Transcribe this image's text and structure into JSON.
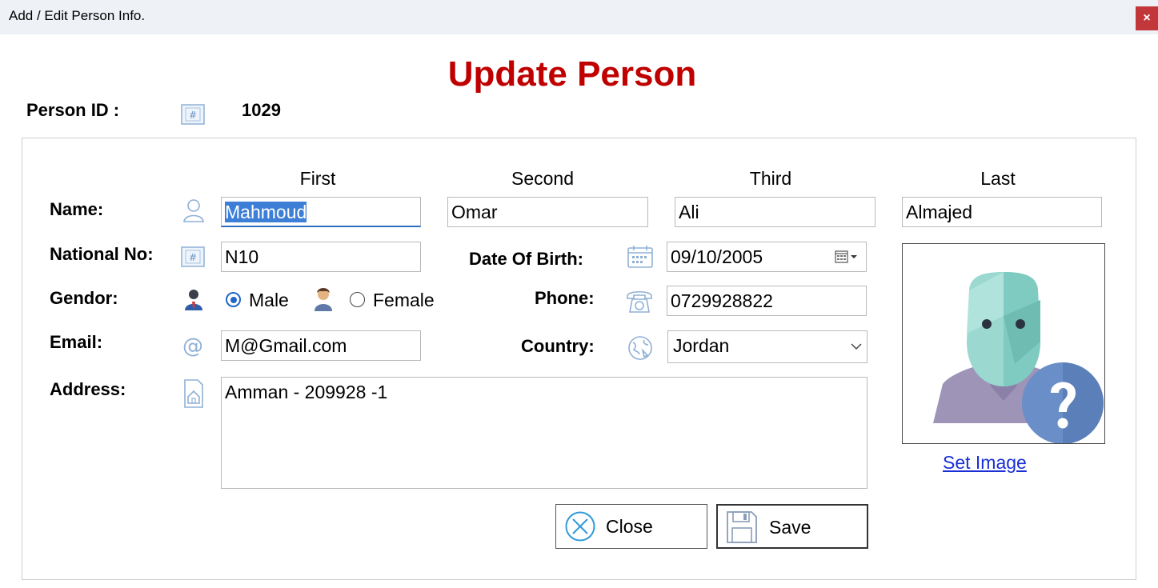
{
  "window": {
    "title": "Add / Edit Person Info.",
    "close_label": "×"
  },
  "heading": "Update Person",
  "person_id": {
    "label": "Person ID :",
    "value": "1029"
  },
  "name": {
    "label": "Name:",
    "columns": {
      "first": "First",
      "second": "Second",
      "third": "Third",
      "last": "Last"
    },
    "first": "Mahmoud",
    "second": "Omar",
    "third": "Ali",
    "last": "Almajed"
  },
  "national_no": {
    "label": "National No:",
    "value": "N10"
  },
  "gender": {
    "label": "Gendor:",
    "male": "Male",
    "female": "Female",
    "selected": "Male"
  },
  "email": {
    "label": "Email:",
    "value": "M@Gmail.com"
  },
  "address": {
    "label": "Address:",
    "value": "Amman - 209928 -1"
  },
  "dob": {
    "label": "Date Of Birth:",
    "value": "09/10/2005"
  },
  "phone": {
    "label": "Phone:",
    "value": "0729928822"
  },
  "country": {
    "label": "Country:",
    "value": "Jordan"
  },
  "image": {
    "link": "Set Image"
  },
  "buttons": {
    "close": "Close",
    "save": "Save"
  },
  "colors": {
    "heading": "#c00000",
    "accent": "#1f67c7",
    "link": "#1a2fd6",
    "window_close": "#c2383a"
  }
}
